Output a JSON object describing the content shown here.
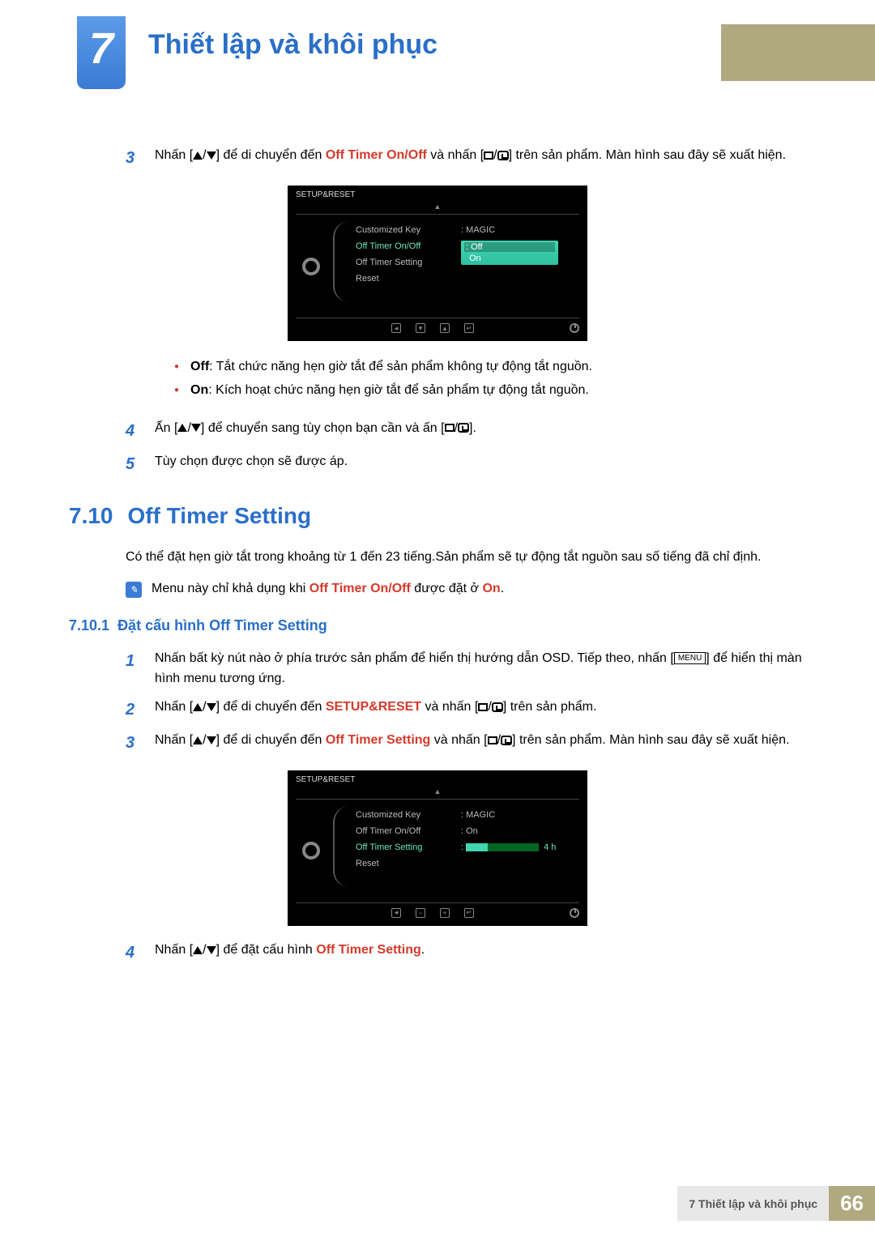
{
  "chapter": {
    "number": "7",
    "title": "Thiết lập và khôi phục"
  },
  "steps_a": {
    "3": {
      "num": "3",
      "pre": "Nhấn [",
      "mid1": "] để di chuyển đến ",
      "bold1": "Off Timer On/Off",
      "mid2": " và nhấn [",
      "post": "] trên sản phẩm. Màn hình sau đây sẽ xuất hiện."
    },
    "4": {
      "num": "4",
      "pre": "Ấn [",
      "mid1": "] để chuyển sang tùy chọn bạn cần và ấn [",
      "post": "]."
    },
    "5": {
      "num": "5",
      "text": "Tùy chọn được chọn sẽ được áp."
    }
  },
  "osd1": {
    "title": "SETUP&RESET",
    "rows": {
      "customized": "Customized Key",
      "offtimer_onoff": "Off Timer On/Off",
      "offtimer_setting": "Off Timer Setting",
      "reset": "Reset"
    },
    "values": {
      "customized": "MAGIC",
      "dropdown_off": "Off",
      "dropdown_on": "On"
    }
  },
  "bullets": {
    "off": {
      "label": "Off",
      "text": ": Tắt chức năng hẹn giờ tắt để sản phẩm không tự động tắt nguồn."
    },
    "on": {
      "label": "On",
      "text": ": Kích hoạt chức năng hẹn giờ tắt để sản phẩm tự động tắt nguồn."
    }
  },
  "section": {
    "num": "7.10",
    "title": "Off Timer Setting",
    "para": "Có thể đặt hẹn giờ tắt trong khoảng từ 1 đến 23 tiếng.Sản phẩm sẽ tự động tắt nguồn sau số tiếng đã chỉ định.",
    "note_pre": "Menu này chỉ khả dụng khi ",
    "note_bold": "Off Timer On/Off",
    "note_mid": " được đặt ở ",
    "note_bold2": "On",
    "note_post": "."
  },
  "subsection": {
    "num": "7.10.1",
    "title": "Đặt cấu hình Off Timer Setting"
  },
  "steps_b": {
    "1": {
      "num": "1",
      "pre": "Nhấn bất kỳ nút nào ở phía trước sản phẩm để hiển thị hướng dẫn OSD. Tiếp theo, nhấn [",
      "menu": "MENU",
      "post": "] để hiển thị màn hình menu tương ứng."
    },
    "2": {
      "num": "2",
      "pre": "Nhấn [",
      "mid1": "] để di chuyển đến ",
      "bold1": "SETUP&RESET",
      "mid2": " và nhấn [",
      "post": "] trên sản phẩm."
    },
    "3": {
      "num": "3",
      "pre": "Nhấn [",
      "mid1": "] để di chuyển đến ",
      "bold1": "Off Timer Setting",
      "mid2": " và nhấn [",
      "post": "] trên sản phẩm. Màn hình sau đây sẽ xuất hiện."
    },
    "4": {
      "num": "4",
      "pre": "Nhấn [",
      "mid1": "] để đặt cấu hình ",
      "bold1": "Off Timer Setting",
      "post": "."
    }
  },
  "osd2": {
    "title": "SETUP&RESET",
    "rows": {
      "customized": "Customized Key",
      "offtimer_onoff": "Off Timer On/Off",
      "offtimer_setting": "Off Timer Setting",
      "reset": "Reset"
    },
    "values": {
      "customized": "MAGIC",
      "offtimer_onoff": "On",
      "slider_label": "4 h"
    }
  },
  "footer": {
    "label": "7 Thiết lập và khôi phục",
    "page": "66"
  }
}
